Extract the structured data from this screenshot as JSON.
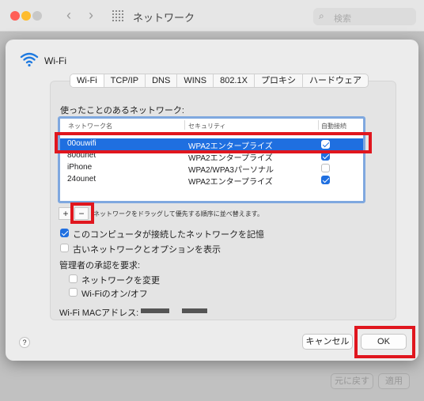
{
  "window": {
    "title": "ネットワーク",
    "search_placeholder": "検索",
    "bg_buttons": [
      "元に戻す",
      "適用"
    ]
  },
  "sheet": {
    "title": "Wi-Fi",
    "tabs": [
      "Wi-Fi",
      "TCP/IP",
      "DNS",
      "WINS",
      "802.1X",
      "プロキシ",
      "ハードウェア"
    ],
    "active_tab": "Wi-Fi",
    "networks_label": "使ったことのあるネットワーク:",
    "columns": [
      "ネットワーク名",
      "セキュリティ",
      "自動接続"
    ],
    "networks": [
      {
        "name": "00ouwifi",
        "security": "WPA2エンタープライズ",
        "auto": true,
        "selected": true
      },
      {
        "name": "80ounet",
        "security": "WPA2エンタープライズ",
        "auto": true,
        "selected": false
      },
      {
        "name": "iPhone",
        "security": "WPA2/WPA3パーソナル",
        "auto": false,
        "selected": false
      },
      {
        "name": "24ounet",
        "security": "WPA2エンタープライズ",
        "auto": true,
        "selected": false
      }
    ],
    "add_label": "+",
    "remove_label": "−",
    "drag_hint": "ネットワークをドラッグして優先する順序に並べ替えます。",
    "remember_label": "このコンピュータが接続したネットワークを記憶",
    "remember_checked": true,
    "legacy_label": "古いネットワークとオプションを表示",
    "legacy_checked": false,
    "admin_label": "管理者の承認を要求:",
    "admin_change_network": "ネットワークを変更",
    "admin_wifi_toggle": "Wi-Fiのオン/オフ",
    "mac_label": "Wi-Fi MACアドレス:",
    "help_label": "?",
    "cancel_label": "キャンセル",
    "ok_label": "OK"
  },
  "colors": {
    "accent": "#1f6fe0",
    "highlight": "#e0161e"
  }
}
